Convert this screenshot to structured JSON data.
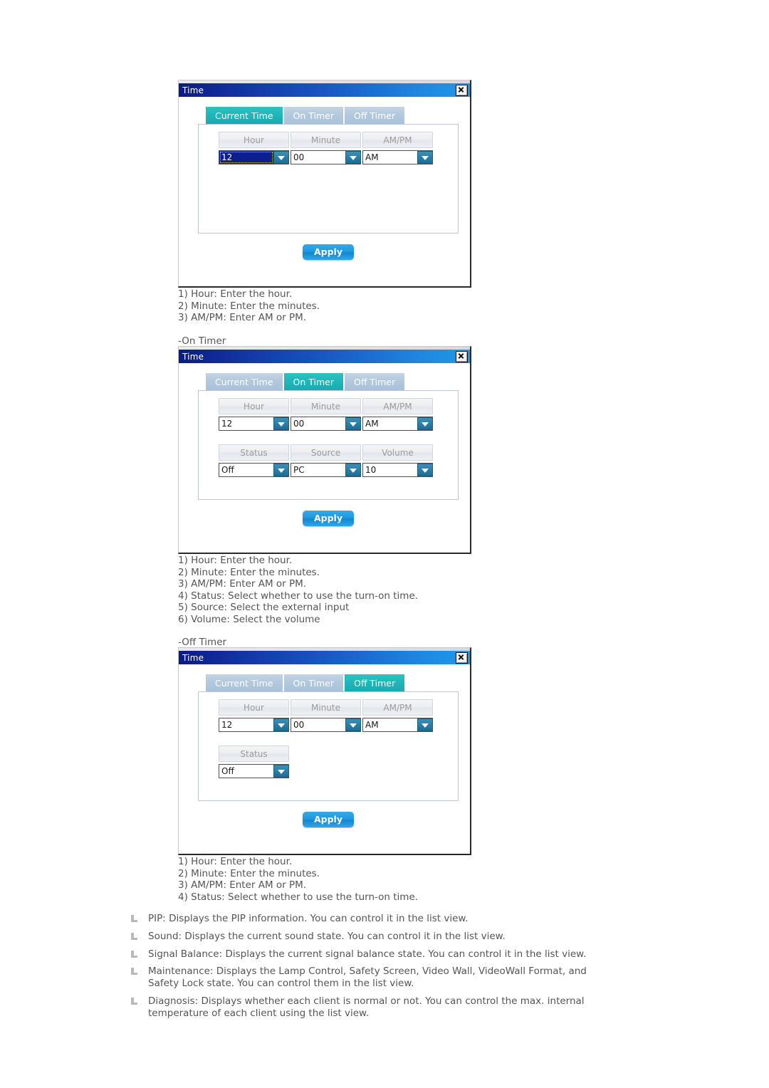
{
  "page": {
    "background": "#ffffff"
  },
  "colors": {
    "titlebar_start": "#0b1b84",
    "titlebar_end": "#1f9ae8",
    "tab_active": "#1fb5b9",
    "tab_inactive": "#b2c8dd",
    "apply_button": "#1f9ae0",
    "panel_border": "#bcc4e0",
    "combo_arrow": "#2a7fa8",
    "selection_highlight": "#0c1f8c",
    "text": "#555555"
  },
  "dialogs": [
    {
      "id": "current-time",
      "title": "Time",
      "close_icon": "close-icon",
      "tabs": [
        {
          "label": "Current Time",
          "active": true
        },
        {
          "label": "On Timer",
          "active": false
        },
        {
          "label": "Off Timer",
          "active": false
        }
      ],
      "fields_row1": [
        {
          "label": "Hour",
          "value": "12",
          "selected": true
        },
        {
          "label": "Minute",
          "value": "00",
          "selected": false
        },
        {
          "label": "AM/PM",
          "value": "AM",
          "selected": false
        }
      ],
      "fields_row2": [],
      "apply_label": "Apply"
    },
    {
      "id": "on-timer",
      "title": "Time",
      "close_icon": "close-icon",
      "tabs": [
        {
          "label": "Current Time",
          "active": false
        },
        {
          "label": "On Timer",
          "active": true
        },
        {
          "label": "Off Timer",
          "active": false
        }
      ],
      "fields_row1": [
        {
          "label": "Hour",
          "value": "12",
          "selected": false
        },
        {
          "label": "Minute",
          "value": "00",
          "selected": false
        },
        {
          "label": "AM/PM",
          "value": "AM",
          "selected": false
        }
      ],
      "fields_row2": [
        {
          "label": "Status",
          "value": "Off",
          "selected": false
        },
        {
          "label": "Source",
          "value": "PC",
          "selected": false
        },
        {
          "label": "Volume",
          "value": "10",
          "selected": false
        }
      ],
      "apply_label": "Apply"
    },
    {
      "id": "off-timer",
      "title": "Time",
      "close_icon": "close-icon",
      "tabs": [
        {
          "label": "Current Time",
          "active": false
        },
        {
          "label": "On Timer",
          "active": false
        },
        {
          "label": "Off Timer",
          "active": true
        }
      ],
      "fields_row1": [
        {
          "label": "Hour",
          "value": "12",
          "selected": false
        },
        {
          "label": "Minute",
          "value": "00",
          "selected": false
        },
        {
          "label": "AM/PM",
          "value": "AM",
          "selected": false
        }
      ],
      "fields_row2": [
        {
          "label": "Status",
          "value": "Off",
          "selected": false
        }
      ],
      "apply_label": "Apply"
    }
  ],
  "captions": {
    "current_time_notes": "1) Hour: Enter the hour.\n2) Minute: Enter the minutes.\n3) AM/PM: Enter AM or PM.",
    "on_timer_heading": "-On Timer",
    "on_timer_notes": "1) Hour: Enter the hour.\n2) Minute: Enter the minutes.\n3) AM/PM: Enter AM or PM.\n4) Status: Select whether to use the turn-on time.\n5) Source: Select the external input\n6) Volume: Select the volume",
    "off_timer_heading": "-Off Timer",
    "off_timer_notes": "1) Hour: Enter the hour.\n2) Minute: Enter the minutes.\n3) AM/PM: Enter AM or PM.\n4) Status: Select whether to use the turn-on time."
  },
  "bullets": [
    {
      "text": "PIP: Displays the PIP information. You can control it in the list view."
    },
    {
      "text": "Sound: Displays the current sound state. You can control it in the list view."
    },
    {
      "text": "Signal Balance: Displays the current signal balance state. You can control it in the list view."
    },
    {
      "text": "Maintenance: Displays the Lamp Control, Safety Screen, Video Wall, VideoWall Format, and Safety Lock state. You can control them in the list view."
    },
    {
      "text": "Diagnosis: Displays whether each client is normal or not. You can control the max. internal temperature of each client using the list view."
    }
  ]
}
